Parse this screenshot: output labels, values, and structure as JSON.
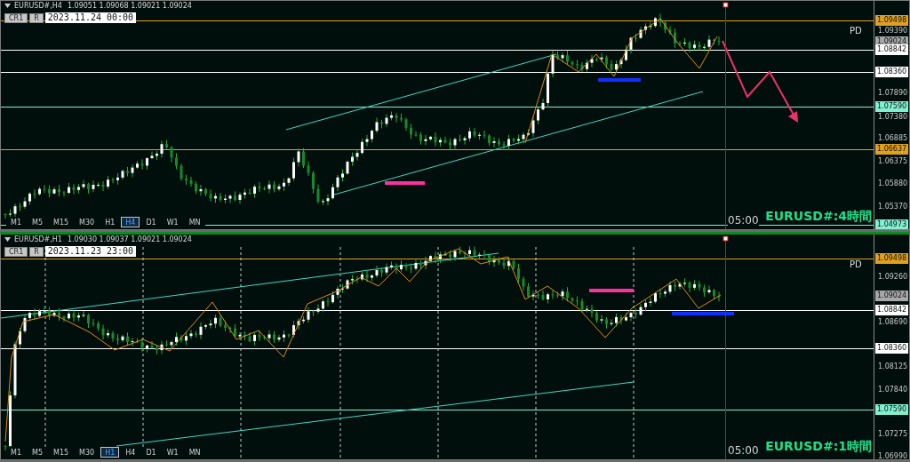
{
  "panels": [
    {
      "symbol": "EURUSD#,H4",
      "ohlc": "1.09051 1.09068 1.09021 1.09024",
      "buttons": [
        "CR1",
        "R"
      ],
      "date": "2023.11.24 00:00",
      "pd_label": "PD",
      "time_label": "05:00",
      "title": "EURUSD#:4時間",
      "axis_ticks": [
        "1.09390",
        "1.07890",
        "1.07380",
        "1.06885",
        "1.06375",
        "1.05880",
        "1.05370"
      ],
      "price_tags": [
        {
          "text": "1.09498",
          "color": "#e0a020",
          "line": true
        },
        {
          "text": "1.09024",
          "color": "#a8a8a8",
          "line": false
        },
        {
          "text": "1.08842",
          "color": "#ffffff",
          "line": true
        },
        {
          "text": "1.08360",
          "color": "#ffffff",
          "line": true
        },
        {
          "text": "1.07590",
          "color": "#80f0d0",
          "line": true
        },
        {
          "text": "1.06637",
          "color": "#e0a020",
          "line": true
        },
        {
          "text": "1.04973",
          "color": "#80f0d0",
          "line": true
        }
      ],
      "timeframes": [
        {
          "label": "M1",
          "selected": false
        },
        {
          "label": "M5",
          "selected": false
        },
        {
          "label": "M15",
          "selected": false
        },
        {
          "label": "M30",
          "selected": false
        },
        {
          "label": "H1",
          "selected": false
        },
        {
          "label": "H4",
          "selected": true
        },
        {
          "label": "D1",
          "selected": false
        },
        {
          "label": "W1",
          "selected": false
        },
        {
          "label": "MN",
          "selected": false
        }
      ]
    },
    {
      "symbol": "EURUSD#,H1",
      "ohlc": "1.09030 1.09037 1.09021 1.09024",
      "buttons": [
        "CR1",
        "R"
      ],
      "date": "2023.11.23 23:00",
      "pd_label": "PD",
      "time_label": "05:00",
      "title": "EURUSD#:1時間",
      "axis_ticks": [
        "1.09260",
        "1.08690",
        "1.08125",
        "1.07840",
        "1.07275",
        "1.06990"
      ],
      "price_tags": [
        {
          "text": "1.09498",
          "color": "#e0a020",
          "line": true
        },
        {
          "text": "1.09024",
          "color": "#a8a8a8",
          "line": false
        },
        {
          "text": "1.08842",
          "color": "#ffffff",
          "line": true
        },
        {
          "text": "1.08360",
          "color": "#ffffff",
          "line": true
        },
        {
          "text": "1.07590",
          "color": "#80f0d0",
          "line": true
        }
      ],
      "timeframes": [
        {
          "label": "M1",
          "selected": false
        },
        {
          "label": "M5",
          "selected": false
        },
        {
          "label": "M15",
          "selected": false
        },
        {
          "label": "M30",
          "selected": false
        },
        {
          "label": "H1",
          "selected": true
        },
        {
          "label": "H4",
          "selected": false
        },
        {
          "label": "D1",
          "selected": false
        },
        {
          "label": "W1",
          "selected": false
        },
        {
          "label": "MN",
          "selected": false
        }
      ]
    }
  ]
}
